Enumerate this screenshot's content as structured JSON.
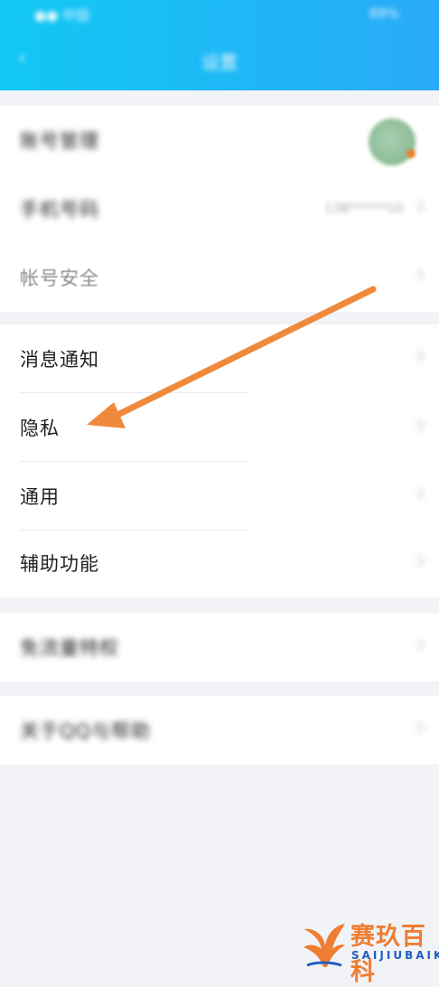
{
  "status_bar": {
    "left": "●● 中国",
    "right": "89%"
  },
  "header": {
    "title": "设置",
    "back_glyph": "‹"
  },
  "groups": [
    {
      "items": [
        {
          "label": "账号管理"
        },
        {
          "label": "手机号码",
          "value": "138******10"
        },
        {
          "label": "帐号安全"
        }
      ]
    },
    {
      "items": [
        {
          "label": "消息通知"
        },
        {
          "label": "隐私"
        },
        {
          "label": "通用"
        },
        {
          "label": "辅助功能"
        }
      ]
    },
    {
      "items": [
        {
          "label": "免流量特权"
        }
      ]
    },
    {
      "items": [
        {
          "label": "关于QQ与帮助"
        }
      ]
    }
  ],
  "annotation": {
    "color": "#ef8a3c",
    "points_to": "隐私"
  },
  "watermark": {
    "name": "赛玖百科",
    "sub": "SAIJIUBAIKE"
  },
  "colors": {
    "header_start": "#12c8f3",
    "header_end": "#29aaf8",
    "page_bg": "#f2f3f7",
    "brand_orange": "#ef7d32"
  }
}
